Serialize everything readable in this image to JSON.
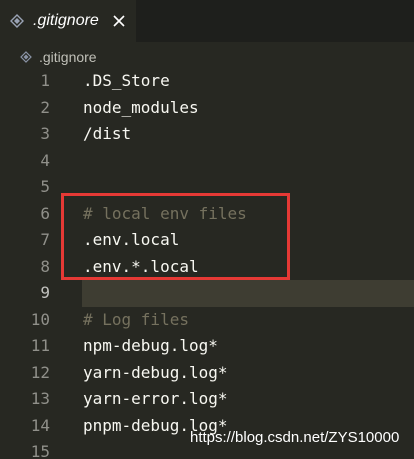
{
  "tab": {
    "title": ".gitignore",
    "icon": "diamond-icon",
    "close_icon": "close-icon"
  },
  "breadcrumb": {
    "icon": "diamond-icon",
    "label": ".gitignore"
  },
  "lines": [
    {
      "number": "1",
      "text": ".DS_Store",
      "kind": "text"
    },
    {
      "number": "2",
      "text": "node_modules",
      "kind": "text"
    },
    {
      "number": "3",
      "text": "/dist",
      "kind": "text"
    },
    {
      "number": "4",
      "text": "",
      "kind": "text"
    },
    {
      "number": "5",
      "text": "",
      "kind": "text"
    },
    {
      "number": "6",
      "text": "# local env files",
      "kind": "comment"
    },
    {
      "number": "7",
      "text": ".env.local",
      "kind": "text"
    },
    {
      "number": "8",
      "text": ".env.*.local",
      "kind": "text"
    },
    {
      "number": "9",
      "text": "",
      "kind": "text"
    },
    {
      "number": "10",
      "text": "# Log files",
      "kind": "comment"
    },
    {
      "number": "11",
      "text": "npm-debug.log*",
      "kind": "text"
    },
    {
      "number": "12",
      "text": "yarn-debug.log*",
      "kind": "text"
    },
    {
      "number": "13",
      "text": "yarn-error.log*",
      "kind": "text"
    },
    {
      "number": "14",
      "text": "pnpm-debug.log*",
      "kind": "text"
    },
    {
      "number": "15",
      "text": "",
      "kind": "text"
    }
  ],
  "current_line": "9",
  "colors": {
    "background": "#272822",
    "comment": "#75715e",
    "highlight_box": "#e53935"
  },
  "watermark": "https://blog.csdn.net/ZYS10000"
}
